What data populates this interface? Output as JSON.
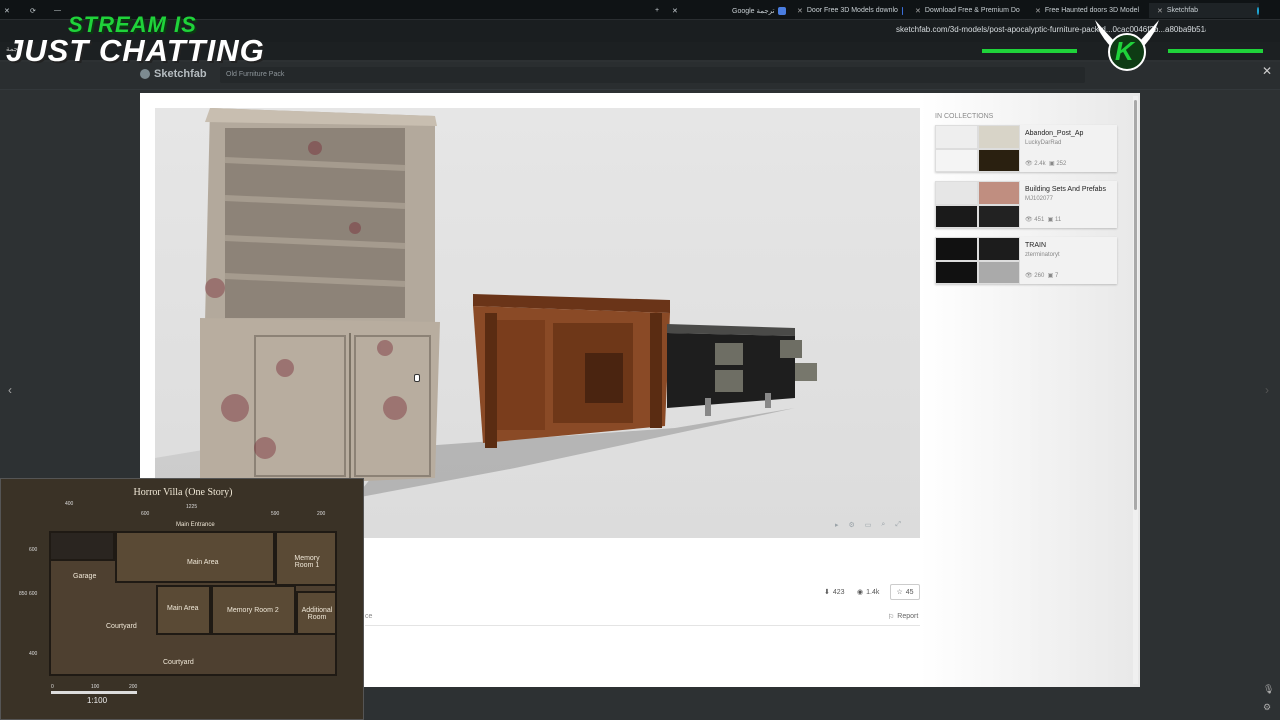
{
  "browser": {
    "tabs": [
      {
        "label": "Google ترجمة",
        "color": "#4a7de0"
      },
      {
        "label": "Door Free 3D Models downlo",
        "color": "#3b6ed8"
      },
      {
        "label": "Download Free & Premium Do",
        "color": "#e0692d"
      },
      {
        "label": "Free Haunted doors 3D Model",
        "color": "#4a7de0"
      },
      {
        "label": "Sketchfab",
        "color": "#1caad9"
      }
    ],
    "url": "sketchfab.com/3d-models/post-apocalyptic-furniture-pack-d...0cac0046f2b...a80ba9b51a",
    "bookmark": "ترجمة"
  },
  "overlay": {
    "line1": "STREAM IS",
    "line2": "JUST CHATTING",
    "brand_letter": "K"
  },
  "sketchfab": {
    "logo": "Sketchfab",
    "search_value": "Old Furniture Pack"
  },
  "stats": {
    "downloads": "423",
    "views": "1.4k",
    "likes": "45",
    "report": "Report",
    "partial_left": "ce"
  },
  "collections": {
    "heading": "IN COLLECTIONS",
    "items": [
      {
        "title": "Abandon_Post_Ap",
        "user": "LuckyDarRad",
        "views": "2.4k",
        "models": "252"
      },
      {
        "title": "Building Sets And Prefabs",
        "user": "MJ102077",
        "views": "451",
        "models": "11"
      },
      {
        "title": "TRAIN",
        "user": "zterminatoryt",
        "views": "260",
        "models": "7"
      }
    ]
  },
  "floorplan": {
    "title": "Horror Villa (One Story)",
    "main_entrance": "Main Entrance",
    "rooms": [
      "Main Area",
      "Memory Room 1",
      "Garage",
      "Main Area",
      "Memory Room 2",
      "Additional Room",
      "Courtyard",
      "Courtyard"
    ],
    "dims_top": [
      "400",
      "1225",
      "600",
      "590",
      "200"
    ],
    "dims_left": [
      "600",
      "850",
      "600",
      "400"
    ],
    "scale_ticks": [
      "0",
      "100",
      "200"
    ],
    "scale_label": "1:100"
  },
  "colors": {
    "stream_green": "#1fd33a",
    "modal_bg": "#ffffff"
  }
}
